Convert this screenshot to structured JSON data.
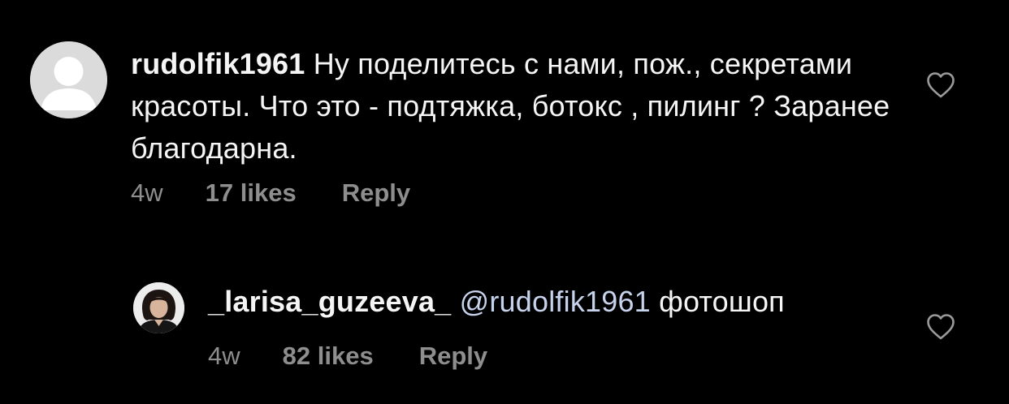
{
  "comment": {
    "username": "rudolfik1961",
    "text": "Ну поделитесь с нами, пож., секретами красоты. Что это - подтяжка, ботокс , пилинг ? Заранее благодарна.",
    "age": "4w",
    "likes": "17 likes",
    "reply_label": "Reply",
    "avatar_icon": "default-profile-icon",
    "like_icon": "heart-outline-icon"
  },
  "reply": {
    "username": "_larisa_guzeeva_",
    "mention": "@rudolfik1961",
    "text": "фотошоп",
    "age": "4w",
    "likes": "82 likes",
    "reply_label": "Reply",
    "avatar_icon": "profile-photo",
    "like_icon": "heart-outline-icon"
  },
  "colors": {
    "background": "#000000",
    "primary_text": "#f5f5f5",
    "secondary_text": "#8e8e8e",
    "mention": "#c7d3ec"
  }
}
